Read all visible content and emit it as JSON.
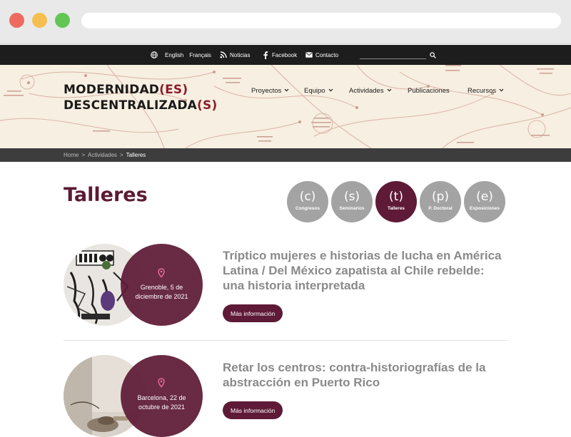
{
  "topbar": {
    "lang_english": "English",
    "lang_francais": "Français",
    "noticias": "Noticias",
    "facebook": "Facebook",
    "contacto": "Contacto"
  },
  "logo": {
    "line1_main": "MODERNIDAD",
    "line1_accent": "(ES)",
    "line2_main": "DESCENTRALIZADA",
    "line2_accent": "(S)"
  },
  "nav": {
    "proyectos": "Proyectos",
    "equipo": "Equipo",
    "actividades": "Actividades",
    "publicaciones": "Publicaciones",
    "recursos": "Recursos"
  },
  "breadcrumb": {
    "home": "Home",
    "actividades": "Actividades",
    "current": "Talleres",
    "sep": ">"
  },
  "page": {
    "title": "Talleres"
  },
  "categories": [
    {
      "letter": "(c)",
      "label": "Congresos"
    },
    {
      "letter": "(s)",
      "label": "Seminarios"
    },
    {
      "letter": "(t)",
      "label": "Talleres"
    },
    {
      "letter": "(p)",
      "label": "P. Doctoral"
    },
    {
      "letter": "(e)",
      "label": "Exposiciones"
    }
  ],
  "events": [
    {
      "title": "Tríptico mujeres e historias de lucha en América Latina / Del México zapatista al Chile rebelde: una historia interpretada",
      "date_line1": "Grenoble, 5 de",
      "date_line2": "diciembre de 2021",
      "button": "Más información"
    },
    {
      "title": "Retar los centros: contra-historiografías de la abstracción en Puerto Rico",
      "date_line1": "Barcelona, 22 de",
      "date_line2": "octubre de 2021",
      "button": "Más información"
    }
  ],
  "colors": {
    "accent": "#5e1a36",
    "logo_accent": "#8c1c2c",
    "category_inactive": "#a3a3a3"
  }
}
